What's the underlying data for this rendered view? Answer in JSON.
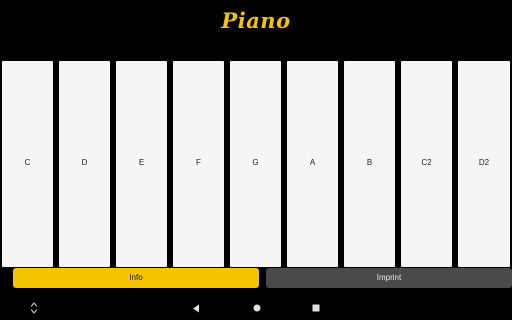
{
  "app": {
    "title": "Piano"
  },
  "keys": [
    {
      "label": "C"
    },
    {
      "label": "D"
    },
    {
      "label": "E"
    },
    {
      "label": "F"
    },
    {
      "label": "G"
    },
    {
      "label": "A"
    },
    {
      "label": "B"
    },
    {
      "label": "C2"
    },
    {
      "label": "D2"
    }
  ],
  "buttons": {
    "info_label": "Info",
    "imprint_label": "Imprint"
  },
  "colors": {
    "background": "#000000",
    "accent": "#f5c400",
    "key_fill": "#f5f5f5",
    "secondary_button": "#4a4a4a"
  },
  "navbar": {
    "icons": [
      "rotate-icon",
      "back-icon",
      "home-icon",
      "recents-icon"
    ]
  }
}
